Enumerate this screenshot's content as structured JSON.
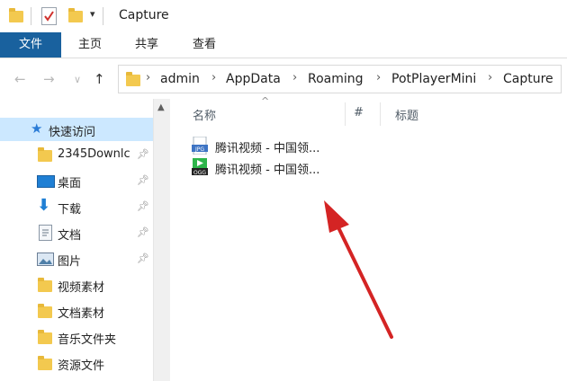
{
  "window": {
    "title": "Capture"
  },
  "ribbon": {
    "tabs": [
      "文件",
      "主页",
      "共享",
      "查看"
    ]
  },
  "address": {
    "crumbs": [
      "admin",
      "AppData",
      "Roaming",
      "PotPlayerMini",
      "Capture"
    ]
  },
  "nav": {
    "quick_access": "快速访问",
    "items": [
      {
        "label": "2345Downlc",
        "icon": "folder-icon",
        "pinned": true
      },
      {
        "label": "桌面",
        "icon": "desktop-icon",
        "pinned": true
      },
      {
        "label": "下载",
        "icon": "download-icon",
        "pinned": true
      },
      {
        "label": "文档",
        "icon": "document-icon",
        "pinned": true
      },
      {
        "label": "图片",
        "icon": "pictures-icon",
        "pinned": true
      },
      {
        "label": "视频素材",
        "icon": "folder-icon",
        "pinned": false
      },
      {
        "label": "文档素材",
        "icon": "folder-icon",
        "pinned": false
      },
      {
        "label": "音乐文件夹",
        "icon": "folder-icon",
        "pinned": false
      },
      {
        "label": "资源文件",
        "icon": "folder-icon",
        "pinned": false
      }
    ]
  },
  "content": {
    "columns": [
      "名称",
      "#",
      "标题"
    ],
    "files": [
      {
        "name": "腾讯视频 - 中国领...",
        "type": "JPG",
        "icon": "jpg-file-icon"
      },
      {
        "name": "腾讯视频 - 中国领...",
        "type": "OGG",
        "icon": "ogg-file-icon"
      }
    ]
  },
  "colors": {
    "file_tab": "#19619e",
    "folder": "#f3c94f",
    "annotation_arrow": "#d42424",
    "selected_nav": "#cce8ff"
  }
}
